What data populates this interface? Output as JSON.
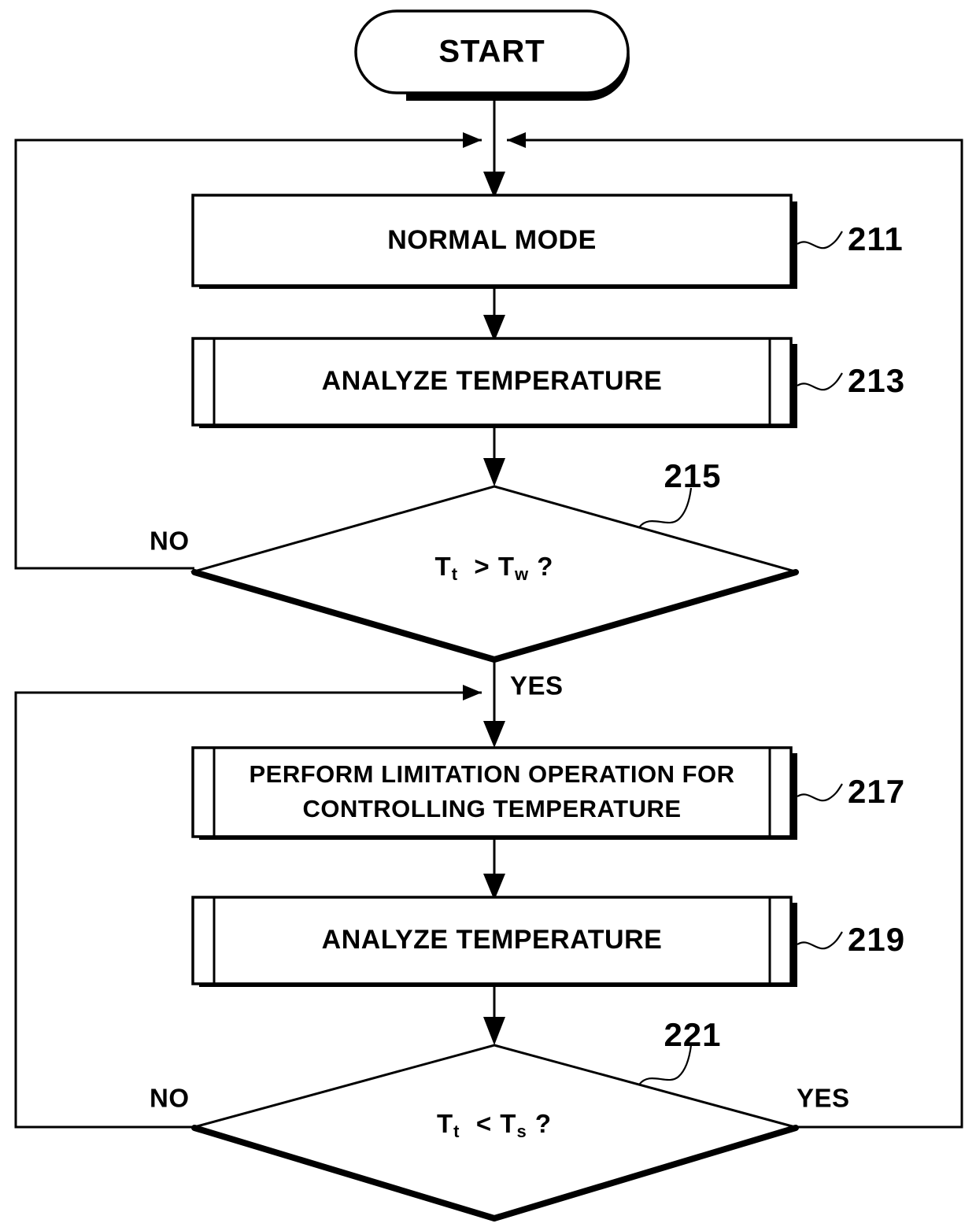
{
  "figure": {
    "type": "flowchart",
    "title": "Temperature control flowchart",
    "background_color": "#ffffff",
    "line_color": "#000000"
  },
  "nodes": {
    "start": {
      "shape": "terminator",
      "label": "START"
    },
    "n211": {
      "shape": "process",
      "label": "NORMAL MODE",
      "ref": "211"
    },
    "n213": {
      "shape": "predefined-process",
      "label": "ANALYZE TEMPERATURE",
      "ref": "213"
    },
    "n215": {
      "shape": "decision",
      "label_left": "T",
      "label_left_sub": "t",
      "operator": ">",
      "label_right": "T",
      "label_right_sub": "w",
      "question": "?",
      "ref": "215",
      "branch_no": "NO",
      "branch_yes": "YES"
    },
    "n217": {
      "shape": "predefined-process",
      "label_line1": "PERFORM LIMITATION OPERATION FOR",
      "label_line2": "CONTROLLING TEMPERATURE",
      "ref": "217"
    },
    "n219": {
      "shape": "predefined-process",
      "label": "ANALYZE TEMPERATURE",
      "ref": "219"
    },
    "n221": {
      "shape": "decision",
      "label_left": "T",
      "label_left_sub": "t",
      "operator": "<",
      "label_right": "T",
      "label_right_sub": "s",
      "question": "?",
      "ref": "221",
      "branch_no": "NO",
      "branch_yes": "YES"
    }
  },
  "edges": [
    {
      "from": "start",
      "to": "n211",
      "label": ""
    },
    {
      "from": "n211",
      "to": "n213",
      "label": ""
    },
    {
      "from": "n213",
      "to": "n215",
      "label": ""
    },
    {
      "from": "n215",
      "to": "n211",
      "label": "NO"
    },
    {
      "from": "n215",
      "to": "n217",
      "label": "YES"
    },
    {
      "from": "n217",
      "to": "n219",
      "label": ""
    },
    {
      "from": "n219",
      "to": "n221",
      "label": ""
    },
    {
      "from": "n221",
      "to": "n217",
      "label": "NO"
    },
    {
      "from": "n221",
      "to": "n211",
      "label": "YES"
    }
  ]
}
